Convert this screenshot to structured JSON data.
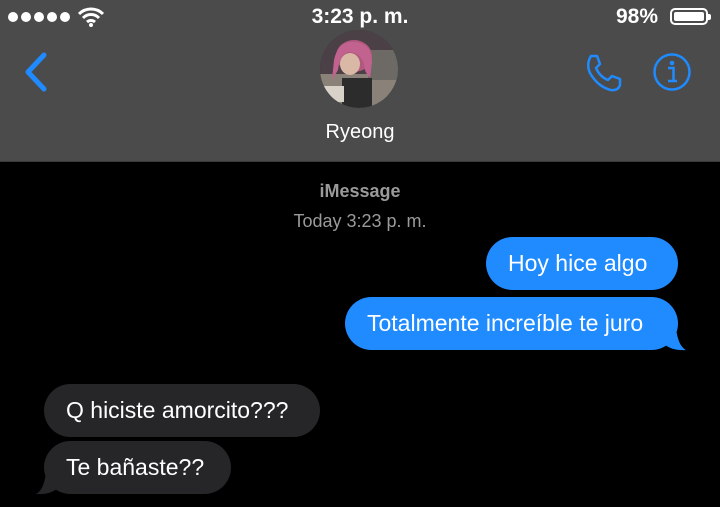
{
  "status_bar": {
    "time": "3:23 p. m.",
    "battery": "98%",
    "icons": [
      "signal-dots",
      "wifi-icon",
      "battery-icon"
    ]
  },
  "nav": {
    "back_icon": "chevron-left-icon",
    "contact_name": "Ryeong",
    "call_icon": "phone-icon",
    "info_icon": "info-icon",
    "accent": "#1f8bff"
  },
  "conversation": {
    "service": "iMessage",
    "timestamp": "Today 3:23 p. m.",
    "messages": [
      {
        "direction": "sent",
        "text": "Hoy hice algo"
      },
      {
        "direction": "sent",
        "text": "Totalmente increíble te juro"
      },
      {
        "direction": "received",
        "text": "Q hiciste amorcito???"
      },
      {
        "direction": "received",
        "text": "Te bañaste??"
      }
    ]
  },
  "colors": {
    "header_bg": "#4b4b4b",
    "background": "#000000",
    "sent_bubble": "#1f8bff",
    "received_bubble": "#262628"
  }
}
